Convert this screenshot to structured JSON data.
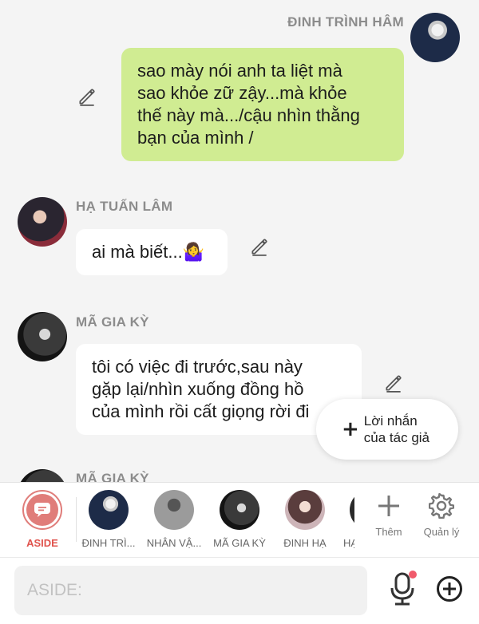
{
  "messages": [
    {
      "sender": "ĐINH TRÌNH HÂM",
      "side": "right",
      "lines": [
        "sao mày nói anh ta liệt mà",
        "sao khỏe zữ zậy...mà khỏe",
        "thế này mà.../cậu nhìn thằng",
        "bạn của mình /"
      ]
    },
    {
      "sender": "HẠ TUẤN LÂM",
      "side": "left",
      "lines": [
        "ai mà biết...🤷‍♀️"
      ]
    },
    {
      "sender": "MÃ GIA KỲ",
      "side": "left",
      "lines": [
        "tôi có việc đi trước,sau này",
        "gặp lại/nhìn xuống đồng hồ",
        "của mình rồi cất giọng rời đi"
      ]
    },
    {
      "sender": "MÃ GIA KỲ",
      "side": "left",
      "lines": []
    }
  ],
  "fab": {
    "plus": "+",
    "label_line1": "Lời nhắn",
    "label_line2": "của tác giả"
  },
  "characters": [
    {
      "label": "ASIDE",
      "selected": true
    },
    {
      "label": "ĐINH TRÌ..."
    },
    {
      "label": "NHÂN VẬ..."
    },
    {
      "label": "MÃ GIA KỲ"
    },
    {
      "label": "ĐINH HẠ"
    },
    {
      "label": "HẠ"
    }
  ],
  "tools": {
    "add_label": "Thêm",
    "manage_label": "Quản lý"
  },
  "input": {
    "placeholder": "ASIDE:"
  },
  "colors": {
    "own_bubble": "#d0ec92",
    "other_bubble": "#ffffff",
    "accent": "#e07d7a",
    "mic_dot": "#f05a6b"
  },
  "icons": {
    "edit": "pencil-icon",
    "add": "plus-icon",
    "manage": "gear-icon",
    "mic": "microphone-icon",
    "attach": "plus-circle-icon",
    "aside": "chat-bubble-icon"
  }
}
